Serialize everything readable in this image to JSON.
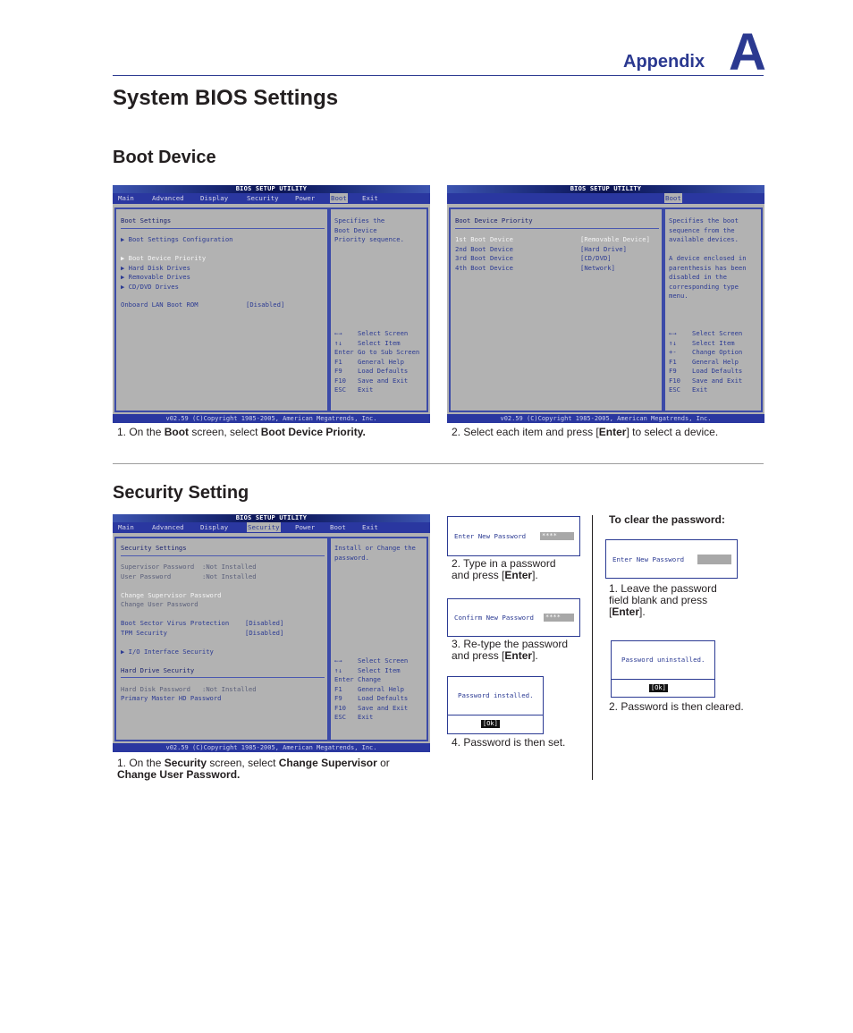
{
  "header": {
    "appendix_label": "Appendix",
    "appendix_letter": "A",
    "accent_color": "#2b3990"
  },
  "page_title": "System BIOS Settings",
  "boot_section": {
    "title": "Boot Device",
    "screen1": {
      "title": "BIOS SETUP UTILITY",
      "menu": [
        "Main",
        "Advanced",
        "Display",
        "Security",
        "Power",
        "Boot",
        "Exit"
      ],
      "active_menu": "Boot",
      "panel_heading": "Boot Settings",
      "items": [
        {
          "label": "▶ Boot Settings Configuration"
        },
        {
          "label": "▶ Boot Device Priority",
          "highlighted": true
        },
        {
          "label": "▶ Hard Disk Drives"
        },
        {
          "label": "▶ Removable Drives"
        },
        {
          "label": "▶ CD/DVD Drives"
        }
      ],
      "option": {
        "label": "Onboard LAN Boot ROM",
        "value": "[Disabled]"
      },
      "help_text": [
        "Specifies the",
        "Boot Device",
        "Priority sequence."
      ],
      "keys": [
        {
          "key": "←→",
          "desc": "Select Screen"
        },
        {
          "key": "↑↓",
          "desc": "Select Item"
        },
        {
          "key": "Enter",
          "desc": "Go to Sub Screen"
        },
        {
          "key": "F1",
          "desc": "General Help"
        },
        {
          "key": "F9",
          "desc": "Load Defaults"
        },
        {
          "key": "F10",
          "desc": "Save and Exit"
        },
        {
          "key": "ESC",
          "desc": "Exit"
        }
      ],
      "footer": "v02.59 (C)Copyright 1985-2005, American Megatrends, Inc."
    },
    "caption1": {
      "prefix": "1. On the ",
      "bold1": "Boot",
      "middle": " screen, select ",
      "bold2": "Boot Device Priority."
    },
    "screen2": {
      "title": "BIOS SETUP UTILITY",
      "active_menu": "Boot",
      "panel_heading": "Boot Device Priority",
      "devices": [
        {
          "label": "1st Boot Device",
          "value": "[Removable Device]",
          "highlighted": true
        },
        {
          "label": "2nd Boot Device",
          "value": "[Hard Drive]"
        },
        {
          "label": "3rd Boot Device",
          "value": "[CD/DVD]"
        },
        {
          "label": "4th Boot Device",
          "value": "[Network]"
        }
      ],
      "help_text": [
        "Specifies the boot",
        "sequence from the",
        "available devices.",
        "",
        "A device enclosed in",
        "parenthesis has been",
        "disabled in the",
        "corresponding type",
        "menu."
      ],
      "keys": [
        {
          "key": "←→",
          "desc": "Select Screen"
        },
        {
          "key": "↑↓",
          "desc": "Select Item"
        },
        {
          "key": "+-",
          "desc": "Change Option"
        },
        {
          "key": "F1",
          "desc": "General Help"
        },
        {
          "key": "F9",
          "desc": "Load Defaults"
        },
        {
          "key": "F10",
          "desc": "Save and Exit"
        },
        {
          "key": "ESC",
          "desc": "Exit"
        }
      ],
      "footer": "v02.59 (C)Copyright 1985-2005, American Megatrends, Inc."
    },
    "caption2": {
      "prefix": "2. Select each item and press [",
      "bold": "Enter",
      "suffix": "] to select a device."
    }
  },
  "security_section": {
    "title": "Security Setting",
    "screen": {
      "title": "BIOS SETUP UTILITY",
      "menu": [
        "Main",
        "Advanced",
        "Display",
        "Security",
        "Power",
        "Boot",
        "Exit"
      ],
      "active_menu": "Security",
      "panel_heading": "Security Settings",
      "status": [
        {
          "label": "Supervisor Password",
          "value": ":Not Installed"
        },
        {
          "label": "User Password",
          "value": ":Not Installed"
        }
      ],
      "change_supervisor": "Change Supervisor Password",
      "change_user": "Change User Password",
      "options": [
        {
          "label": "Boot Sector Virus Protection",
          "value": "[Disabled]"
        },
        {
          "label": "TPM Security",
          "value": "[Disabled]"
        }
      ],
      "io_item": "▶ I/O Interface Security",
      "hd_heading": "Hard Drive Security",
      "hd_status": {
        "label": "Hard Disk Password",
        "value": ":Not Installed"
      },
      "hd_item": "Primary Master HD Password",
      "help_text": [
        "Install or Change the",
        "password."
      ],
      "keys": [
        {
          "key": "←→",
          "desc": "Select Screen"
        },
        {
          "key": "↑↓",
          "desc": "Select Item"
        },
        {
          "key": "Enter",
          "desc": "Change"
        },
        {
          "key": "F1",
          "desc": "General Help"
        },
        {
          "key": "F9",
          "desc": "Load Defaults"
        },
        {
          "key": "F10",
          "desc": "Save and Exit"
        },
        {
          "key": "ESC",
          "desc": "Exit"
        }
      ],
      "footer": "v02.59 (C)Copyright 1985-2005, American Megatrends, Inc."
    },
    "caption1": {
      "prefix": "1. On the ",
      "bold1": "Security",
      "middle": " screen, select ",
      "bold2": "Change Supervisor",
      "middle2": " or",
      "bold3": "Change User Password."
    },
    "set_steps": {
      "dialog1": {
        "label": "Enter New Password",
        "value": "****"
      },
      "caption2": {
        "prefix": "2. Type in a password",
        "line2_prefix": "and press [",
        "bold": "Enter",
        "suffix": "]."
      },
      "dialog2": {
        "label": "Confirm New Password",
        "value": "****"
      },
      "caption3": {
        "prefix": "3. Re-type the password",
        "line2_prefix": "and press [",
        "bold": "Enter",
        "suffix": "]."
      },
      "dialog3": {
        "message": "Password installed.",
        "ok": "[Ok]"
      },
      "caption4": "4. Password is then set."
    },
    "clear_steps": {
      "heading": "To clear the password:",
      "dialog1": {
        "label": "Enter New Password",
        "value": ""
      },
      "caption1": {
        "line1": "1. Leave the password",
        "line2": "field blank and press",
        "prefix3": "[",
        "bold": "Enter",
        "suffix3": "]."
      },
      "dialog2": {
        "message": "Password uninstalled.",
        "ok": "[Ok]"
      },
      "caption2": "2. Password is then cleared."
    }
  }
}
